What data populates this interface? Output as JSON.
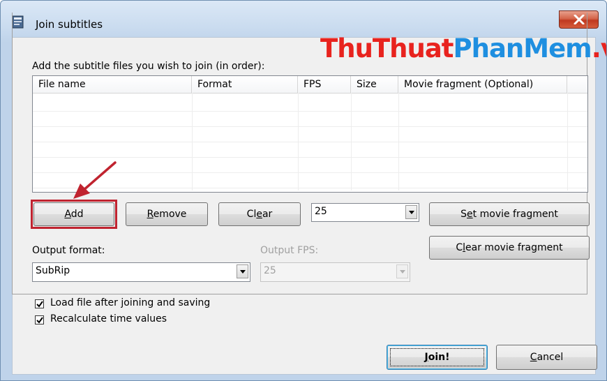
{
  "window": {
    "title": "Join subtitles",
    "close_glyph": "✕"
  },
  "watermark": {
    "part1": "ThuThuat",
    "part2": "PhanMem",
    "part3": ".vn"
  },
  "instructions": "Add the subtitle files you wish to join (in order):",
  "list": {
    "columns": [
      "File name",
      "Format",
      "FPS",
      "Size",
      "Movie fragment (Optional)"
    ]
  },
  "buttons": {
    "add_mnemonic": "A",
    "add_rest": "dd",
    "remove_mnemonic": "R",
    "remove_rest": "emove",
    "clear_pre": "Cl",
    "clear_mnemonic": "e",
    "clear_rest": "ar",
    "set_fragment_pre": "S",
    "set_fragment_mnemonic": "e",
    "set_fragment_rest": "t movie fragment",
    "clear_fragment_pre": "C",
    "clear_fragment_mnemonic": "l",
    "clear_fragment_rest": "ear movie fragment",
    "join_mnemonic": "J",
    "join_rest": "oin!",
    "cancel_mnemonic": "C",
    "cancel_rest": "ancel"
  },
  "fps_combo": {
    "value": "25"
  },
  "output_format": {
    "label": "Output format:",
    "value": "SubRip"
  },
  "output_fps": {
    "label": "Output FPS:",
    "value": "25"
  },
  "options": {
    "load_file": {
      "label": "Load file after joining and saving",
      "checked": true
    },
    "recalculate": {
      "label": "Recalculate time values",
      "checked": true
    }
  },
  "colors": {
    "highlight": "#c0232f",
    "watermark_red": "#e8231e",
    "watermark_blue": "#1f8fe0"
  }
}
